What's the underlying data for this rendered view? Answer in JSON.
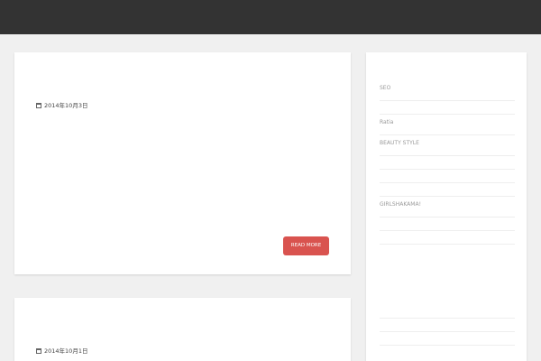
{
  "header": {
    "site_title": "",
    "nav": [
      "",
      ""
    ]
  },
  "posts": [
    {
      "title": "",
      "date": "2014年10月3日",
      "excerpt_lines": [
        "",
        "",
        "",
        "",
        "",
        "",
        "",
        "",
        "",
        ""
      ],
      "read_more": "READ MORE"
    },
    {
      "title": "",
      "date": "2014年10月1日"
    }
  ],
  "sidebar": {
    "widgets": [
      {
        "title": "",
        "items": [
          "SEO",
          "",
          "Ratia",
          "BEAUTY STYLE",
          "",
          "",
          "",
          "GIRLSHAKAMA!",
          "",
          ""
        ]
      },
      {
        "title": "",
        "items": [
          "",
          "",
          ""
        ]
      }
    ]
  },
  "colors": {
    "header_bg": "#333333",
    "page_bg": "#f0f0f0",
    "card_bg": "#ffffff",
    "button_bg": "#d9534f",
    "sidebar_link": "#9a9a9a"
  },
  "icons": {
    "date": "calendar-icon"
  }
}
